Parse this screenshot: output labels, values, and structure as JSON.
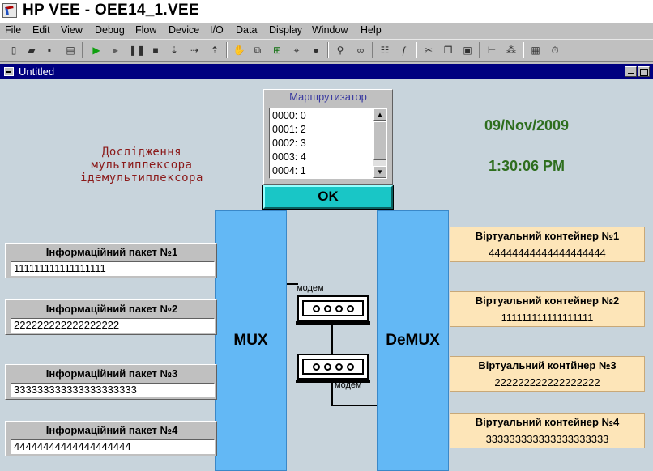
{
  "app": {
    "title": "HP VEE - OEE14_1.VEE"
  },
  "menu": [
    "File",
    "Edit",
    "View",
    "Debug",
    "Flow",
    "Device",
    "I/O",
    "Data",
    "Display",
    "Window",
    "Help"
  ],
  "toolbar": [
    "new-icon",
    "open-icon",
    "save-icon",
    "print-icon",
    "run-icon",
    "step-icon",
    "pause-icon",
    "stop-icon",
    "step-into-icon",
    "step-over-icon",
    "step-out-icon",
    "hand-icon",
    "copy-object-icon",
    "connect-icon",
    "line-probe-icon",
    "record-icon",
    "find-icon",
    "binoculars-icon",
    "properties-icon",
    "formula-icon",
    "cut-icon",
    "copy-icon",
    "paste-icon",
    "align-icon",
    "clean-up-icon",
    "panel-icon",
    "timer-icon"
  ],
  "window": {
    "title": "Untitled"
  },
  "description": [
    "Дослідження",
    "мультиплексора",
    "ідемультиплексора"
  ],
  "date": "09/Nov/2009",
  "time": "1:30:06 PM",
  "router": {
    "title": "Маршрутизатор",
    "items": [
      "0000: 0",
      "0001: 2",
      "0002: 3",
      "0003: 4",
      "0004: 1"
    ]
  },
  "ok_label": "OK",
  "mux_label": "MUX",
  "demux_label": "DeMUX",
  "modem_label": "модем",
  "packets": [
    {
      "label": "Інформаційний пакет №1",
      "value": "111111111111111111"
    },
    {
      "label": "Інформаційний пакет №2",
      "value": "222222222222222222"
    },
    {
      "label": "Інформаційний пакет №3",
      "value": "333333333333333333333"
    },
    {
      "label": "Інформаційний пакет №4",
      "value": "44444444444444444444"
    }
  ],
  "containers": [
    {
      "label": "Віртуальний контейнер №1",
      "value": "44444444444444444444"
    },
    {
      "label": "Віртуальний контейнер №2",
      "value": "111111111111111111"
    },
    {
      "label": "Віртуальний контйнер №3",
      "value": "222222222222222222"
    },
    {
      "label": "Віртуальний контейнер №4",
      "value": "333333333333333333333"
    }
  ]
}
